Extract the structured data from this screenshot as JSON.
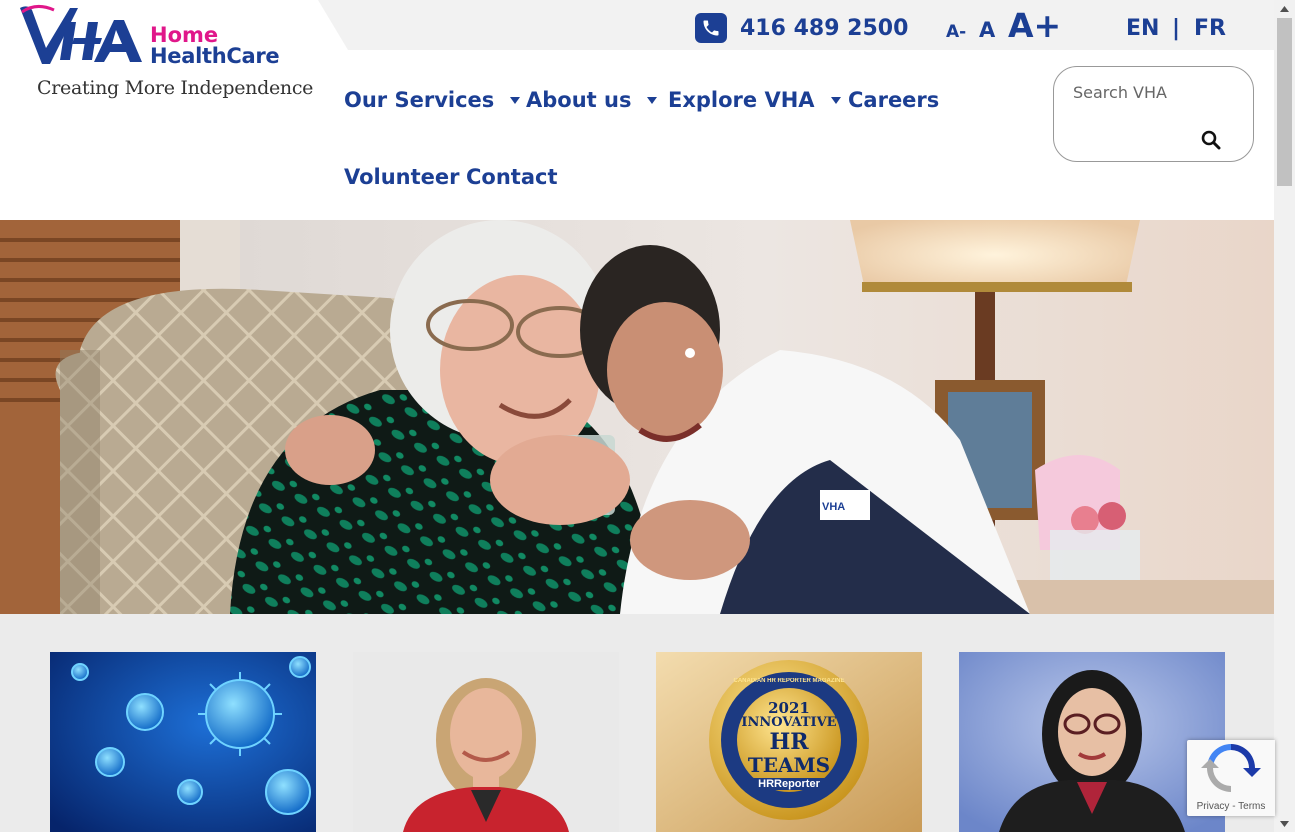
{
  "brand": {
    "logo_mark": "VHA",
    "line1": "Home",
    "line2": "HealthCare",
    "tagline": "Creating More Independence",
    "colors": {
      "primary": "#1c3f94",
      "accent": "#e0178a"
    }
  },
  "topbar": {
    "phone_icon": "phone-icon",
    "phone": "416 489 2500",
    "font_size": {
      "decrease": "A-",
      "normal": "A",
      "increase": "A+"
    },
    "languages": {
      "en": "EN",
      "separator": "|",
      "fr": "FR"
    }
  },
  "nav": {
    "items": [
      {
        "label": "Our Services",
        "has_dropdown": true
      },
      {
        "label": "About us",
        "has_dropdown": true
      },
      {
        "label": "Explore VHA",
        "has_dropdown": true
      },
      {
        "label": "Careers",
        "has_dropdown": false
      },
      {
        "label": "Volunteer",
        "has_dropdown": false
      },
      {
        "label": "Contact",
        "has_dropdown": false
      }
    ]
  },
  "search": {
    "placeholder": "Search VHA",
    "value": "",
    "icon": "search-icon"
  },
  "hero": {
    "image": "caregiver-hugging-senior-photo"
  },
  "cards": [
    {
      "image": "coronavirus-illustration"
    },
    {
      "image": "woman-red-jacket-portrait"
    },
    {
      "image": "award-badge",
      "badge": {
        "arc_text": "CANADIAN HR REPORTER MAGAZINE",
        "year": "2021",
        "line1": "INNOVATIVE",
        "line2": "HR",
        "line3": "TEAMS",
        "footer": "HRReporter"
      }
    },
    {
      "image": "woman-glasses-portrait"
    }
  ],
  "recaptcha": {
    "links": "Privacy - Terms"
  }
}
